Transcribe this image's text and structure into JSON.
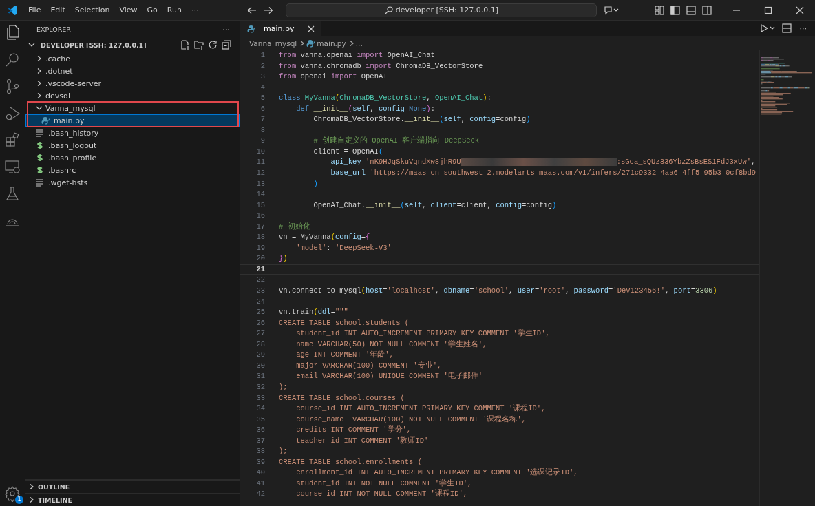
{
  "title_bar": {
    "menu": [
      "File",
      "Edit",
      "Selection",
      "View",
      "Go",
      "Run",
      "···"
    ],
    "search": {
      "value": "developer [SSH: 127.0.0.1]"
    }
  },
  "activity_bar": {
    "settings_badge": "1"
  },
  "explorer": {
    "title": "EXPLORER",
    "more": "···",
    "root": {
      "label": "DEVELOPER [SSH: 127.0.0.1]",
      "expanded": true,
      "children": [
        {
          "label": ".cache",
          "kind": "folder",
          "expanded": false,
          "selected": false,
          "annotated": false
        },
        {
          "label": ".dotnet",
          "kind": "folder",
          "expanded": false,
          "selected": false,
          "annotated": false
        },
        {
          "label": ".vscode-server",
          "kind": "folder",
          "expanded": false,
          "selected": false,
          "annotated": false
        },
        {
          "label": "devsql",
          "kind": "folder",
          "expanded": false,
          "selected": false,
          "annotated": false
        },
        {
          "label": "Vanna_mysql",
          "kind": "folder",
          "expanded": true,
          "selected": false,
          "annotated": true,
          "children": [
            {
              "label": "main.py",
              "kind": "python",
              "selected": true,
              "annotated": false
            }
          ]
        },
        {
          "label": ".bash_history",
          "kind": "text",
          "selected": false,
          "annotated": false
        },
        {
          "label": ".bash_logout",
          "kind": "shell",
          "selected": false,
          "annotated": false
        },
        {
          "label": ".bash_profile",
          "kind": "shell",
          "selected": false,
          "annotated": false
        },
        {
          "label": ".bashrc",
          "kind": "shell",
          "selected": false,
          "annotated": false
        },
        {
          "label": ".wget-hsts",
          "kind": "text",
          "selected": false,
          "annotated": false
        }
      ]
    },
    "sections": [
      {
        "label": "OUTLINE",
        "expanded": false
      },
      {
        "label": "TIMELINE",
        "expanded": false
      }
    ]
  },
  "editor": {
    "tabs": [
      {
        "label": "main.py",
        "selected": true
      }
    ],
    "breadcrumb": [
      "Vanna_mysql",
      "main.py",
      "..."
    ],
    "lines": [
      {
        "number": "1",
        "current": false,
        "tokens": [
          {
            "kind": "kw",
            "text": "from"
          },
          {
            "kind": "p",
            "text": " vanna.openai "
          },
          {
            "kind": "kw",
            "text": "import"
          },
          {
            "kind": "p",
            "text": " OpenAI_Chat"
          }
        ]
      },
      {
        "number": "2",
        "current": false,
        "tokens": [
          {
            "kind": "kw",
            "text": "from"
          },
          {
            "kind": "p",
            "text": " vanna.chromadb "
          },
          {
            "kind": "kw",
            "text": "import"
          },
          {
            "kind": "p",
            "text": " ChromaDB_VectorStore"
          }
        ]
      },
      {
        "number": "3",
        "current": false,
        "tokens": [
          {
            "kind": "kw",
            "text": "from"
          },
          {
            "kind": "p",
            "text": " openai "
          },
          {
            "kind": "kw",
            "text": "import"
          },
          {
            "kind": "p",
            "text": " OpenAI"
          }
        ]
      },
      {
        "number": "4",
        "current": false
      },
      {
        "number": "5",
        "current": false,
        "tokens": [
          {
            "kind": "st",
            "text": "class"
          },
          {
            "kind": "cls",
            "text": " MyVanna"
          },
          {
            "kind": "b1",
            "text": "("
          },
          {
            "kind": "cls",
            "text": "ChromaDB_VectorStore"
          },
          {
            "kind": "p",
            "text": ", "
          },
          {
            "kind": "cls",
            "text": "OpenAI_Chat"
          },
          {
            "kind": "b1",
            "text": ")"
          },
          {
            "kind": "p",
            "text": ":"
          }
        ]
      },
      {
        "number": "6",
        "current": false,
        "tokens": [
          {
            "kind": "st",
            "text": "    def"
          },
          {
            "kind": "fn",
            "text": " __init__"
          },
          {
            "kind": "b2",
            "text": "("
          },
          {
            "kind": "par",
            "text": "self"
          },
          {
            "kind": "p",
            "text": ", "
          },
          {
            "kind": "par",
            "text": "config"
          },
          {
            "kind": "p",
            "text": "="
          },
          {
            "kind": "st",
            "text": "None"
          },
          {
            "kind": "b2",
            "text": ")"
          },
          {
            "kind": "p",
            "text": ":"
          }
        ]
      },
      {
        "number": "7",
        "current": false,
        "tokens": [
          {
            "kind": "p",
            "text": "        ChromaDB_VectorStore."
          },
          {
            "kind": "fn",
            "text": "__init__"
          },
          {
            "kind": "b3",
            "text": "("
          },
          {
            "kind": "par",
            "text": "self"
          },
          {
            "kind": "p",
            "text": ", "
          },
          {
            "kind": "par",
            "text": "config"
          },
          {
            "kind": "p",
            "text": "=config"
          },
          {
            "kind": "b3",
            "text": ")"
          }
        ]
      },
      {
        "number": "8",
        "current": false
      },
      {
        "number": "9",
        "current": false,
        "tokens": [
          {
            "kind": "com",
            "text": "        # 创建自定义的 OpenAI 客户端指向 DeepSeek"
          }
        ]
      },
      {
        "number": "10",
        "current": false,
        "tokens": [
          {
            "kind": "p",
            "text": "        client = OpenAI"
          },
          {
            "kind": "b3",
            "text": "("
          }
        ]
      },
      {
        "number": "11",
        "current": false,
        "tokens": [
          {
            "kind": "par",
            "text": "            api_key"
          },
          {
            "kind": "p",
            "text": "="
          },
          {
            "kind": "str",
            "text": "'nK9HJqSkuVqndXw8jhR9U"
          },
          {
            "kind": "blur"
          },
          {
            "kind": "str",
            "text": ":sGca_sQUz336YbzZsBsES1FdJ3xUw'"
          },
          {
            "kind": "p",
            "text": ","
          }
        ]
      },
      {
        "number": "12",
        "current": false,
        "tokens": [
          {
            "kind": "par",
            "text": "            base_url"
          },
          {
            "kind": "p",
            "text": "="
          },
          {
            "kind": "str",
            "text": "'"
          },
          {
            "kind": "url",
            "text": "https://maas-cn-southwest-2.modelarts-maas.com/v1/infers/271c9332-4aa6-4ff5-95b3-0cf8bd9"
          }
        ]
      },
      {
        "number": "13",
        "current": false,
        "tokens": [
          {
            "kind": "b3",
            "text": "        )"
          }
        ]
      },
      {
        "number": "14",
        "current": false
      },
      {
        "number": "15",
        "current": false,
        "tokens": [
          {
            "kind": "p",
            "text": "        OpenAI_Chat."
          },
          {
            "kind": "fn",
            "text": "__init__"
          },
          {
            "kind": "b3",
            "text": "("
          },
          {
            "kind": "par",
            "text": "self"
          },
          {
            "kind": "p",
            "text": ", "
          },
          {
            "kind": "par",
            "text": "client"
          },
          {
            "kind": "p",
            "text": "=client, "
          },
          {
            "kind": "par",
            "text": "config"
          },
          {
            "kind": "p",
            "text": "=config"
          },
          {
            "kind": "b3",
            "text": ")"
          }
        ]
      },
      {
        "number": "16",
        "current": false
      },
      {
        "number": "17",
        "current": false,
        "tokens": [
          {
            "kind": "com",
            "text": "# 初始化"
          }
        ]
      },
      {
        "number": "18",
        "current": false,
        "tokens": [
          {
            "kind": "p",
            "text": "vn = MyVanna"
          },
          {
            "kind": "b1",
            "text": "("
          },
          {
            "kind": "par",
            "text": "config"
          },
          {
            "kind": "p",
            "text": "="
          },
          {
            "kind": "b2",
            "text": "{"
          }
        ]
      },
      {
        "number": "19",
        "current": false,
        "tokens": [
          {
            "kind": "str",
            "text": "    'model'"
          },
          {
            "kind": "p",
            "text": ": "
          },
          {
            "kind": "str",
            "text": "'DeepSeek-V3'"
          }
        ]
      },
      {
        "number": "20",
        "current": false,
        "tokens": [
          {
            "kind": "b2",
            "text": "}"
          },
          {
            "kind": "b1",
            "text": ")"
          }
        ]
      },
      {
        "number": "21",
        "current": true
      },
      {
        "number": "22",
        "current": false
      },
      {
        "number": "23",
        "current": false,
        "tokens": [
          {
            "kind": "p",
            "text": "vn.connect_to_mysql"
          },
          {
            "kind": "b1",
            "text": "("
          },
          {
            "kind": "par",
            "text": "host"
          },
          {
            "kind": "p",
            "text": "="
          },
          {
            "kind": "str",
            "text": "'localhost'"
          },
          {
            "kind": "p",
            "text": ", "
          },
          {
            "kind": "par",
            "text": "dbname"
          },
          {
            "kind": "p",
            "text": "="
          },
          {
            "kind": "str",
            "text": "'school'"
          },
          {
            "kind": "p",
            "text": ", "
          },
          {
            "kind": "par",
            "text": "user"
          },
          {
            "kind": "p",
            "text": "="
          },
          {
            "kind": "str",
            "text": "'root'"
          },
          {
            "kind": "p",
            "text": ", "
          },
          {
            "kind": "par",
            "text": "password"
          },
          {
            "kind": "p",
            "text": "="
          },
          {
            "kind": "str",
            "text": "'Dev123456!'"
          },
          {
            "kind": "p",
            "text": ", "
          },
          {
            "kind": "par",
            "text": "port"
          },
          {
            "kind": "p",
            "text": "="
          },
          {
            "kind": "num",
            "text": "3306"
          },
          {
            "kind": "b1",
            "text": ")"
          }
        ]
      },
      {
        "number": "24",
        "current": false
      },
      {
        "number": "25",
        "current": false,
        "tokens": [
          {
            "kind": "p",
            "text": "vn.train"
          },
          {
            "kind": "b1",
            "text": "("
          },
          {
            "kind": "par",
            "text": "ddl"
          },
          {
            "kind": "p",
            "text": "="
          },
          {
            "kind": "str",
            "text": "\"\"\""
          }
        ]
      },
      {
        "number": "26",
        "current": false,
        "tokens": [
          {
            "kind": "str",
            "text": "CREATE TABLE school.students ("
          }
        ]
      },
      {
        "number": "27",
        "current": false,
        "tokens": [
          {
            "kind": "str",
            "text": "    student_id INT AUTO_INCREMENT PRIMARY KEY COMMENT '学生ID',"
          }
        ]
      },
      {
        "number": "28",
        "current": false,
        "tokens": [
          {
            "kind": "str",
            "text": "    name VARCHAR(50) NOT NULL COMMENT '学生姓名',"
          }
        ]
      },
      {
        "number": "29",
        "current": false,
        "tokens": [
          {
            "kind": "str",
            "text": "    age INT COMMENT '年龄',"
          }
        ]
      },
      {
        "number": "30",
        "current": false,
        "tokens": [
          {
            "kind": "str",
            "text": "    major VARCHAR(100) COMMENT '专业',"
          }
        ]
      },
      {
        "number": "31",
        "current": false,
        "tokens": [
          {
            "kind": "str",
            "text": "    email VARCHAR(100) UNIQUE COMMENT '电子邮件'"
          }
        ]
      },
      {
        "number": "32",
        "current": false,
        "tokens": [
          {
            "kind": "str",
            "text": ");"
          }
        ]
      },
      {
        "number": "33",
        "current": false,
        "tokens": [
          {
            "kind": "str",
            "text": "CREATE TABLE school.courses ("
          }
        ]
      },
      {
        "number": "34",
        "current": false,
        "tokens": [
          {
            "kind": "str",
            "text": "    course_id INT AUTO_INCREMENT PRIMARY KEY COMMENT '课程ID',"
          }
        ]
      },
      {
        "number": "35",
        "current": false,
        "tokens": [
          {
            "kind": "str",
            "text": "    course_name  VARCHAR(100) NOT NULL COMMENT '课程名称',"
          }
        ]
      },
      {
        "number": "36",
        "current": false,
        "tokens": [
          {
            "kind": "str",
            "text": "    credits INT COMMENT '学分',"
          }
        ]
      },
      {
        "number": "37",
        "current": false,
        "tokens": [
          {
            "kind": "str",
            "text": "    teacher_id INT COMMENT '教师ID'"
          }
        ]
      },
      {
        "number": "38",
        "current": false,
        "tokens": [
          {
            "kind": "str",
            "text": ");"
          }
        ]
      },
      {
        "number": "39",
        "current": false,
        "tokens": [
          {
            "kind": "str",
            "text": "CREATE TABLE school.enrollments ("
          }
        ]
      },
      {
        "number": "40",
        "current": false,
        "tokens": [
          {
            "kind": "str",
            "text": "    enrollment_id INT AUTO_INCREMENT PRIMARY KEY COMMENT '选课记录ID',"
          }
        ]
      },
      {
        "number": "41",
        "current": false,
        "tokens": [
          {
            "kind": "str",
            "text": "    student_id INT NOT NULL COMMENT '学生ID',"
          }
        ]
      },
      {
        "number": "42",
        "current": false,
        "tokens": [
          {
            "kind": "str",
            "text": "    course_id INT NOT NULL COMMENT '课程ID',"
          }
        ]
      }
    ]
  }
}
